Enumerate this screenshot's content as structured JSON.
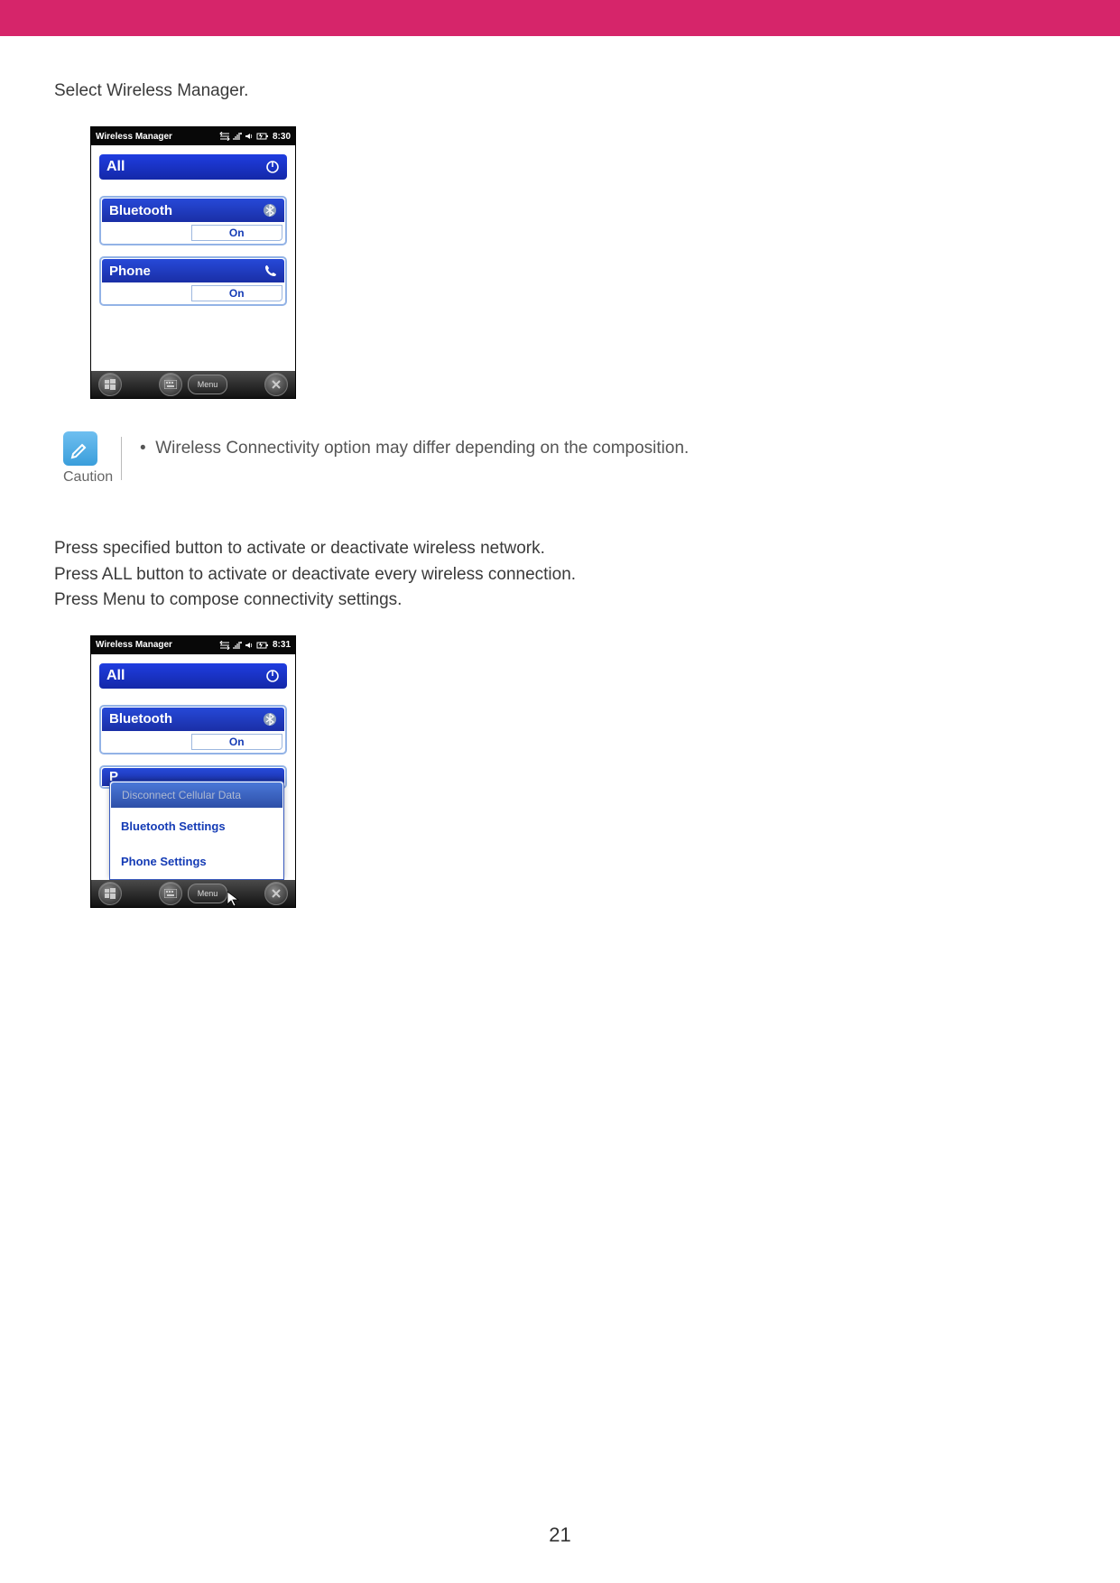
{
  "intro": "Select Wireless Manager.",
  "s1": {
    "title": "Wireless Manager",
    "time": "8:30",
    "all": "All",
    "bt": "Bluetooth",
    "bt_state": "On",
    "phone": "Phone",
    "phone_state": "On",
    "menu": "Menu"
  },
  "caution": {
    "label": "Caution",
    "text": "Wireless Connectivity option may differ depending on the composition."
  },
  "para1": "Press specified button to activate or deactivate wireless network.",
  "para2": "Press ALL button to activate or deactivate every wireless connection.",
  "para3": "Press Menu to compose connectivity settings.",
  "s2": {
    "title": "Wireless Manager",
    "time": "8:31",
    "all": "All",
    "bt": "Bluetooth",
    "bt_state": "On",
    "phone_initial": "P",
    "menu": "Menu",
    "popup": {
      "item1": "Disconnect Cellular Data",
      "item2": "Bluetooth Settings",
      "item3": "Phone Settings"
    }
  },
  "page_number": "21"
}
